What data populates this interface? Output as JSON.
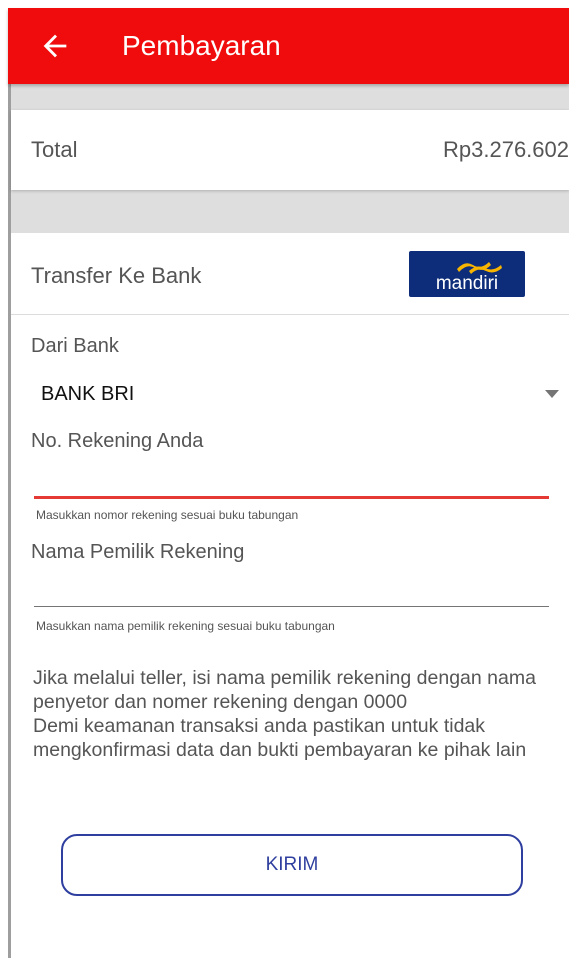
{
  "appbar": {
    "title": "Pembayaran",
    "back_icon": "arrow-left-icon",
    "color": "#f00c0c"
  },
  "total": {
    "label": "Total",
    "value": "Rp3.276.602"
  },
  "transfer": {
    "label": "Transfer Ke Bank",
    "bank_logo_text": "mandiri",
    "bank_logo_icon": "mandiri-logo-icon"
  },
  "form": {
    "from_bank_label": "Dari Bank",
    "from_bank_value": "BANK BRI",
    "account_number_label": "No. Rekening Anda",
    "account_number_value": "",
    "account_number_helper": "Masukkan nomor rekening sesuai buku tabungan",
    "account_name_label": "Nama Pemilik Rekening",
    "account_name_value": "",
    "account_name_helper": "Masukkan nama pemilik rekening sesuai buku tabungan"
  },
  "info": {
    "line1": "Jika melalui teller, isi nama pemilik rekening dengan nama penyetor dan nomer rekening dengan 0000",
    "line2": "Demi keamanan transaksi anda pastikan untuk tidak mengkonfirmasi data dan bukti pembayaran ke pihak lain"
  },
  "submit_label": "KIRIM",
  "colors": {
    "primary": "#f00c0c",
    "button": "#2f3f9f",
    "error_underline": "#e53935"
  }
}
